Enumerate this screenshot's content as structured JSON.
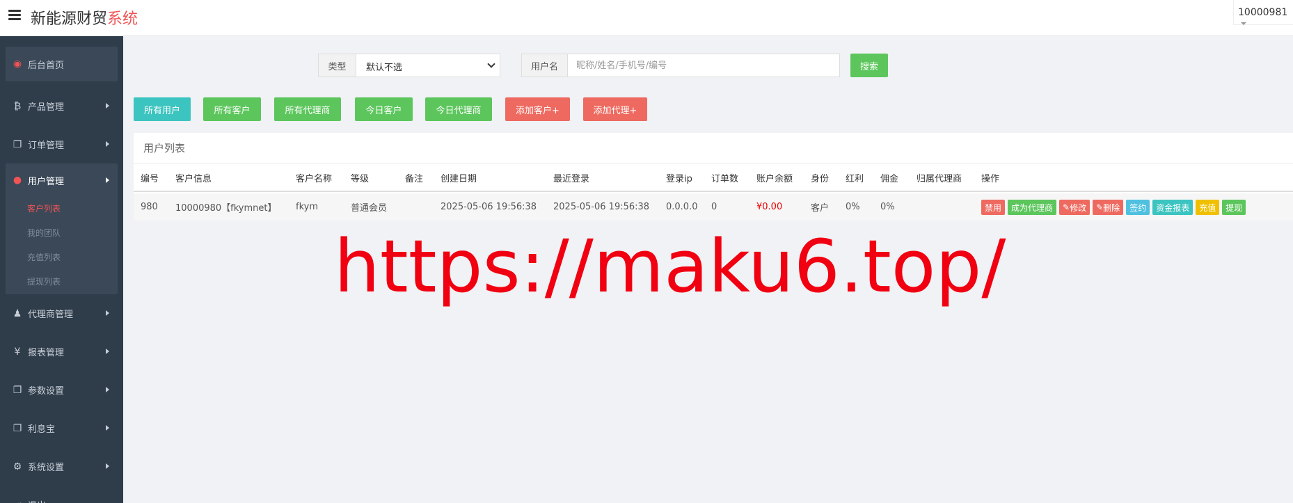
{
  "header": {
    "brand_main": "新能源财贸",
    "brand_accent": "系统",
    "user_id": "10000981",
    "colors": {
      "accent": "#f05454"
    }
  },
  "sidebar": {
    "items": [
      {
        "label": "后台首页",
        "icon": "dashboard-icon"
      },
      {
        "label": "产品管理",
        "icon": "bitcoin-icon"
      },
      {
        "label": "订单管理",
        "icon": "copy-icon"
      },
      {
        "label": "用户管理",
        "icon": "user-icon"
      },
      {
        "label": "代理商管理",
        "icon": "users-icon"
      },
      {
        "label": "报表管理",
        "icon": "yen-icon"
      },
      {
        "label": "参数设置",
        "icon": "copy-icon"
      },
      {
        "label": "利息宝",
        "icon": "copy-icon"
      },
      {
        "label": "系统设置",
        "icon": "gears-icon"
      },
      {
        "label": "退出",
        "icon": "exit-icon"
      }
    ],
    "sub_items": [
      {
        "label": "客户列表"
      },
      {
        "label": "我的团队"
      },
      {
        "label": "充值列表"
      },
      {
        "label": "提现列表"
      }
    ]
  },
  "search": {
    "type_label": "类型",
    "type_value": "默认不选",
    "name_label": "用户名",
    "name_placeholder": "昵称/姓名/手机号/编号",
    "submit": "搜索"
  },
  "filters": [
    {
      "label": "所有用户"
    },
    {
      "label": "所有客户"
    },
    {
      "label": "所有代理商"
    },
    {
      "label": "今日客户"
    },
    {
      "label": "今日代理商"
    },
    {
      "label": "添加客户+"
    },
    {
      "label": "添加代理+"
    }
  ],
  "table": {
    "title": "用户列表",
    "columns": [
      "编号",
      "客户信息",
      "客户名称",
      "等级",
      "备注",
      "创建日期",
      "最近登录",
      "登录ip",
      "订单数",
      "账户余额",
      "身份",
      "红利",
      "佣金",
      "归属代理商",
      "操作"
    ],
    "rows": [
      {
        "id": "980",
        "info": "10000980【fkymnet】",
        "name": "fkym",
        "level": "普通会员",
        "note": "",
        "created": "2025-05-06 19:56:38",
        "last_login": "2025-05-06 19:56:38",
        "ip": "0.0.0.0",
        "orders": "0",
        "balance": "¥0.00",
        "role": "客户",
        "bonus": "0%",
        "commission": "0%",
        "agent": "",
        "actions": [
          "禁用",
          "成为代理商",
          "修改",
          "删除",
          "签约",
          "资金报表",
          "充值",
          "提现"
        ]
      }
    ]
  },
  "watermark": "https://maku6.top/"
}
